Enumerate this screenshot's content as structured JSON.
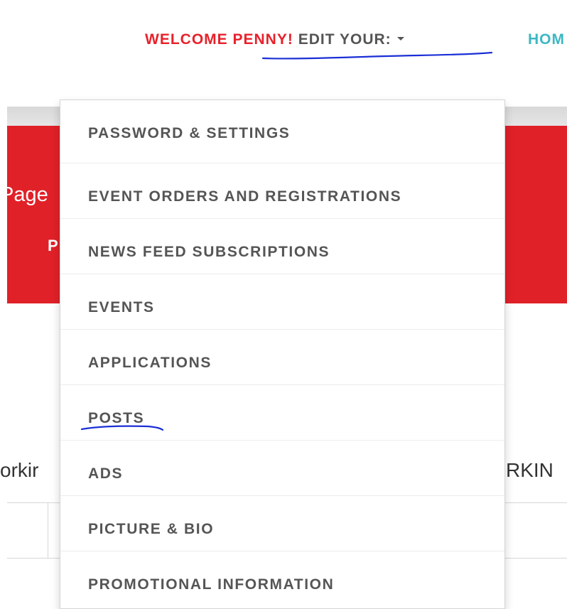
{
  "nav": {
    "welcome_prefix": "WELCOME ",
    "user_name": "PENNY!",
    "edit_label": " EDIT YOUR:",
    "home_label": "HOM"
  },
  "background": {
    "banner_fragment_1": "Page",
    "banner_fragment_2": "P",
    "working_left": "orkir",
    "working_right": "RKIN"
  },
  "dropdown": {
    "items": [
      {
        "label": "PASSWORD & SETTINGS"
      },
      {
        "label": "EVENT ORDERS AND REGISTRATIONS"
      },
      {
        "label": "NEWS FEED SUBSCRIPTIONS"
      },
      {
        "label": "EVENTS"
      },
      {
        "label": "APPLICATIONS"
      },
      {
        "label": "POSTS"
      },
      {
        "label": "ADS"
      },
      {
        "label": "PICTURE & BIO"
      },
      {
        "label": "PROMOTIONAL INFORMATION"
      }
    ]
  },
  "colors": {
    "accent_red": "#e8212b",
    "banner_red": "#e12128",
    "link_teal": "#3bb8c4",
    "menu_text": "#555555",
    "annotation_blue": "#1b2fd6"
  },
  "icons": {
    "dropdown_caret": "caret-down-icon"
  }
}
